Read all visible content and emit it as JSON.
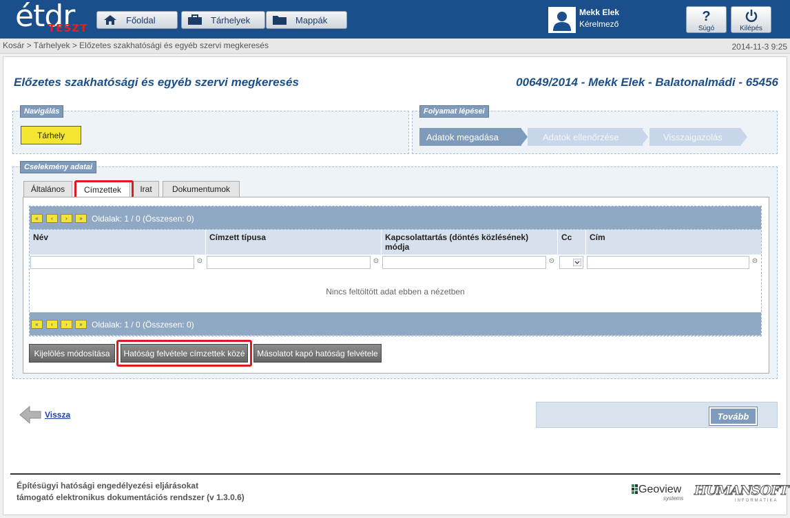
{
  "header": {
    "logo_text": "étdr",
    "logo_badge": "TESZT",
    "nav": [
      {
        "label": "Főoldal",
        "icon": "home-icon"
      },
      {
        "label": "Tárhelyek",
        "icon": "briefcase-icon"
      },
      {
        "label": "Mappák",
        "icon": "folder-icon"
      }
    ],
    "user": {
      "name": "Mekk Elek",
      "role": "Kérelmező"
    },
    "help_label": "Súgó",
    "logout_label": "Kilépés"
  },
  "breadcrumb": "Kosár > Tárhelyek > Előzetes szakhatósági és egyéb szervi megkeresés",
  "datetime": "2014-11-3 9:25",
  "page": {
    "title": "Előzetes szakhatósági és egyéb szervi megkeresés",
    "case": "00649/2014 - Mekk Elek - Balatonalmádi - 65456"
  },
  "navigation": {
    "legend": "Navigálás",
    "button": "Tárhely"
  },
  "process": {
    "legend": "Folyamat lépései",
    "steps": [
      {
        "label": "Adatok megadása",
        "active": true
      },
      {
        "label": "Adatok ellenőrzése",
        "active": false
      },
      {
        "label": "Visszaigazolás",
        "active": false
      }
    ]
  },
  "action_data": {
    "legend": "Cselekmény adatai",
    "tabs": [
      "Általános",
      "Címzettek",
      "Irat",
      "Dokumentumok"
    ],
    "active_tab": "Címzettek",
    "pager_top": "Oldalak: 1 / 0 (Összesen: 0)",
    "pager_bottom": "Oldalak: 1 / 0 (Összesen: 0)",
    "columns": [
      "Név",
      "Címzett típusa",
      "Kapcsolattartás (döntés közlésének) módja",
      "Cc",
      "Cím"
    ],
    "empty_message": "Nincs feltöltött adat ebben a nézetben",
    "buttons": [
      "Kijelölés módosítása",
      "Hatóság felvétele címzettek közé",
      "Másolatot kapó hatóság felvétele"
    ]
  },
  "back_label": "Vissza",
  "next_label": "Tovább",
  "footer": {
    "line1": "Építésügyi hatósági engedélyezési eljárásokat",
    "line2": "támogató elektronikus dokumentációs rendszer (v 1.3.0.6)",
    "geoview": "Geoview",
    "geoview_sub": "systems",
    "humansoft": "HUMANSOFT",
    "humansoft_sub": "INFORMATIKA"
  },
  "colors": {
    "header": "#1a4f8c",
    "accent": "#7f9bbb",
    "highlight": "#e0191e",
    "yellow": "#f5e533"
  }
}
